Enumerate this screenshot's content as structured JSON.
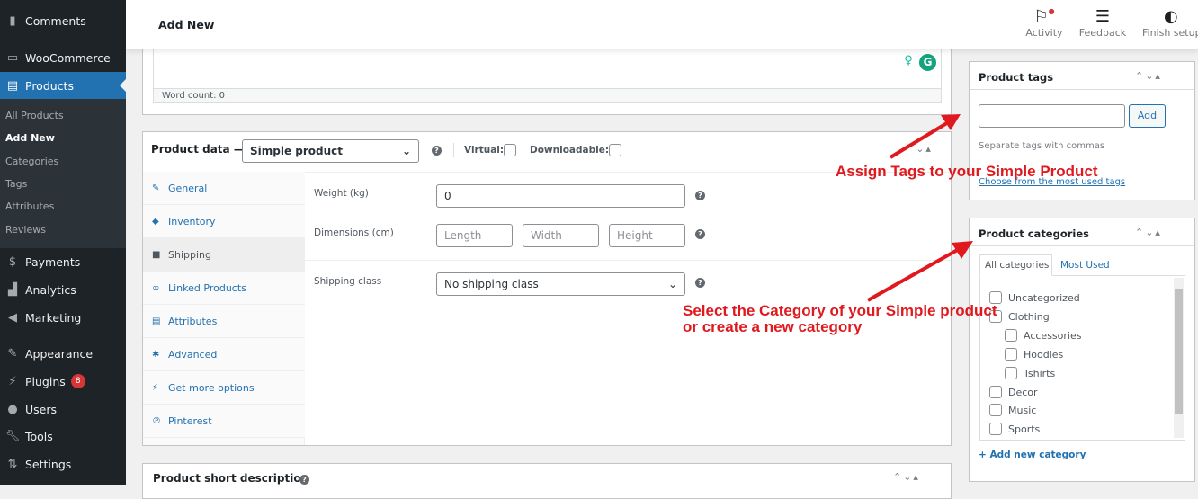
{
  "sidebar": {
    "items": [
      {
        "label": "Comments",
        "icon": "comment-icon"
      },
      {
        "label": "WooCommerce",
        "icon": "woo-icon"
      },
      {
        "label": "Products",
        "icon": "archive-icon"
      },
      {
        "label": "Payments",
        "icon": "dollar-icon"
      },
      {
        "label": "Analytics",
        "icon": "chart-icon"
      },
      {
        "label": "Marketing",
        "icon": "megaphone-icon"
      },
      {
        "label": "Appearance",
        "icon": "brush-icon"
      },
      {
        "label": "Plugins",
        "icon": "plug-icon",
        "badge": "8"
      },
      {
        "label": "Users",
        "icon": "user-icon"
      },
      {
        "label": "Tools",
        "icon": "wrench-icon"
      },
      {
        "label": "Settings",
        "icon": "settings-icon"
      }
    ],
    "submenu": [
      "All Products",
      "Add New",
      "Categories",
      "Tags",
      "Attributes",
      "Reviews"
    ]
  },
  "header": {
    "title": "Add New",
    "buttons": [
      "Activity",
      "Feedback",
      "Finish setup"
    ]
  },
  "editor": {
    "word_count": "Word count: 0"
  },
  "product_data": {
    "title": "Product data —",
    "type": "Simple product",
    "virtual": "Virtual:",
    "downloadable": "Downloadable:",
    "tabs": [
      "General",
      "Inventory",
      "Shipping",
      "Linked Products",
      "Attributes",
      "Advanced",
      "Get more options",
      "Pinterest"
    ],
    "weight_label": "Weight (kg)",
    "weight_value": "0",
    "dimensions_label": "Dimensions (cm)",
    "length_ph": "Length",
    "width_ph": "Width",
    "height_ph": "Height",
    "shipping_class_label": "Shipping class",
    "shipping_class_value": "No shipping class"
  },
  "short_description": {
    "title": "Product short description"
  },
  "tags": {
    "title": "Product tags",
    "add": "Add",
    "hint": "Separate tags with commas",
    "choose": "Choose from the most used tags"
  },
  "categories": {
    "title": "Product categories",
    "tab_all": "All categories",
    "tab_most": "Most Used",
    "items": [
      "Uncategorized",
      "Clothing",
      "Accessories",
      "Hoodies",
      "Tshirts",
      "Decor",
      "Music",
      "Sports"
    ],
    "add": "+ Add new category"
  },
  "annotations": {
    "tags": "Assign Tags to your Simple Product",
    "cat1": "Select the Category of your Simple product",
    "cat2": "or create a new category",
    "color": "#e0191e"
  }
}
